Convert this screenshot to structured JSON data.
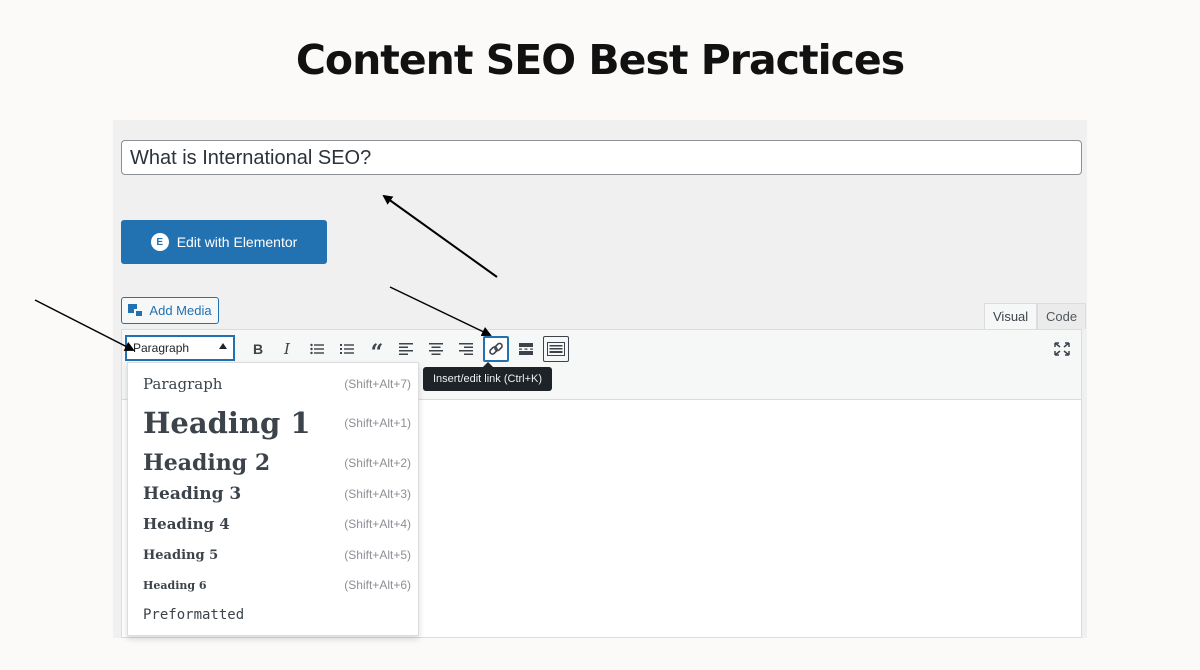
{
  "page_title": "Content SEO Best Practices",
  "post_title": {
    "value": "What is International SEO?"
  },
  "elementor_button": {
    "label": "Edit with Elementor",
    "logo": "E"
  },
  "add_media": {
    "label": "Add Media"
  },
  "tabs": {
    "visual": "Visual",
    "code": "Code"
  },
  "toolbar": {
    "format_select": "Paragraph",
    "buttons": {
      "bold": "B",
      "italic": "I",
      "bullet_list": "☰",
      "numbered_list": "≡",
      "blockquote": "“",
      "align_left": "≡",
      "align_center": "≡",
      "align_right": "≡",
      "link": "link-icon",
      "read_more": "read-more-icon",
      "kitchen_sink": "keyboard-icon",
      "fullscreen": "expand-icon"
    },
    "tooltip": "Insert/edit link (Ctrl+K)"
  },
  "format_dropdown": [
    {
      "label": "Paragraph",
      "shortcut": "(Shift+Alt+7)"
    },
    {
      "label": "Heading 1",
      "shortcut": "(Shift+Alt+1)"
    },
    {
      "label": "Heading 2",
      "shortcut": "(Shift+Alt+2)"
    },
    {
      "label": "Heading 3",
      "shortcut": "(Shift+Alt+3)"
    },
    {
      "label": "Heading 4",
      "shortcut": "(Shift+Alt+4)"
    },
    {
      "label": "Heading 5",
      "shortcut": "(Shift+Alt+5)"
    },
    {
      "label": "Heading 6",
      "shortcut": "(Shift+Alt+6)"
    },
    {
      "label": "Preformatted",
      "shortcut": ""
    }
  ],
  "colors": {
    "accent": "#2271b1",
    "tooltip_bg": "#1d2327"
  }
}
